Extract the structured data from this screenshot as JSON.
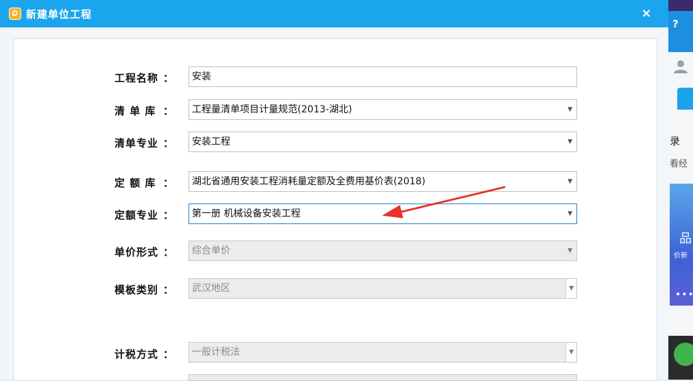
{
  "dialog": {
    "title": "新建单位工程",
    "close": "×"
  },
  "form": {
    "project_name": {
      "label": "工程名称",
      "colon": "：",
      "value": "安装"
    },
    "bill_library": {
      "label": "清 单 库",
      "colon": "：",
      "value": "工程量清单项目计量规范(2013-湖北)"
    },
    "bill_specialty": {
      "label": "清单专业",
      "colon": "：",
      "value": "安装工程"
    },
    "quota_library": {
      "label": "定 额 库",
      "colon": "：",
      "value": "湖北省通用安装工程消耗量定额及全费用基价表(2018)"
    },
    "quota_specialty": {
      "label": "定额专业",
      "colon": "：",
      "value": "第一册 机械设备安装工程"
    },
    "unit_price_form": {
      "label": "单价形式",
      "colon": "：",
      "value": "综合单价"
    },
    "template_type": {
      "label": "模板类别",
      "colon": "：",
      "value": "武汉地区"
    },
    "tax_method": {
      "label": "计税方式",
      "colon": "：",
      "value": "一般计税法"
    }
  },
  "dropdown_icon": "▼",
  "background_window": {
    "help": "?",
    "text1": "录",
    "text2": "看经",
    "banner_text1": "品",
    "banner_text2": "价新",
    "banner_dots": "•••"
  },
  "colors": {
    "titlebar": "#1ba5ec",
    "annotation_arrow": "#e8322b",
    "focus_border": "#1d7fd6"
  }
}
